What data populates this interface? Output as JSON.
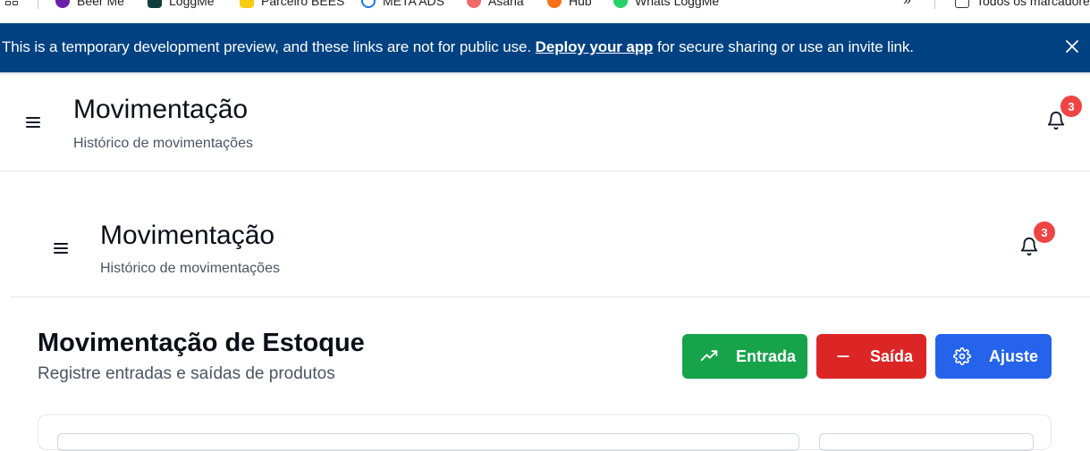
{
  "bookmarks": {
    "items": [
      {
        "label": "Beer Me",
        "color": "#6b21a8"
      },
      {
        "label": "LoggMe",
        "color": "#0f3d3e"
      },
      {
        "label": "Parceiro BEES",
        "color": "#facc15"
      },
      {
        "label": "META ADS",
        "color": "#1877f2"
      },
      {
        "label": "Asana",
        "color": "#f06a6a"
      },
      {
        "label": "Hub",
        "color": "#f97316"
      },
      {
        "label": "Whats LoggMe",
        "color": "#25d366"
      }
    ],
    "overflow_glyph": "»",
    "all_bookmarks_label": "Todos os marcadores"
  },
  "banner": {
    "text_before": "This is a temporary development preview, and these links are not for public use.",
    "link_text": "Deploy your app",
    "text_after": "for secure sharing or use an invite link.",
    "bg_color": "#004182"
  },
  "app_header": {
    "title": "Movimentação",
    "subtitle": "Histórico de movimentações",
    "notification_count": "3"
  },
  "inner_header": {
    "title": "Movimentação",
    "subtitle": "Histórico de movimentações",
    "notification_count": "3"
  },
  "page": {
    "title": "Movimentação de Estoque",
    "subtitle": "Registre entradas e saídas de produtos",
    "actions": {
      "entrada": {
        "label": "Entrada",
        "icon": "trending-up-icon",
        "color": "#16a34a"
      },
      "saida": {
        "label": "Saída",
        "icon": "minus-icon",
        "color": "#dc2626"
      },
      "ajuste": {
        "label": "Ajuste",
        "icon": "gear-icon",
        "color": "#2563eb"
      }
    }
  }
}
